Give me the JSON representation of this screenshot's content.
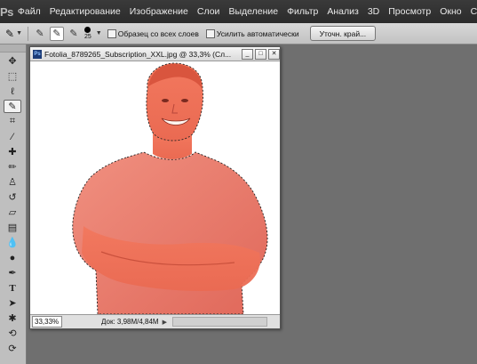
{
  "app": {
    "logo": "Ps"
  },
  "menu": [
    "Файл",
    "Редактирование",
    "Изображение",
    "Слои",
    "Выделение",
    "Фильтр",
    "Анализ",
    "3D",
    "Просмотр",
    "Окно",
    "Справка"
  ],
  "options": {
    "brush_size": "25",
    "sample_all_layers_label": "Образец со всех слоев",
    "auto_enhance_label": "Усилить автоматически",
    "refine_edge_label": "Уточн. край..."
  },
  "toolbox": {
    "tools": [
      "move-icon",
      "marquee-icon",
      "lasso-icon",
      "quick-selection-icon",
      "crop-icon",
      "eyedropper-icon",
      "healing-brush-icon",
      "brush-icon",
      "clone-stamp-icon",
      "history-brush-icon",
      "eraser-icon",
      "gradient-icon",
      "blur-icon",
      "dodge-icon",
      "pen-icon",
      "type-icon",
      "path-selection-icon",
      "shape-icon",
      "3d-rotate-icon",
      "3d-orbit-icon"
    ]
  },
  "document": {
    "title": "Fotolia_8789265_Subscription_XXL.jpg @ 33,3% (Сл...",
    "zoom": "33,33%",
    "doc_size": "Док: 3,98M/4,84M"
  },
  "colors": {
    "menubar": "#2e2e2e",
    "workspace": "#6f6f6f",
    "quick_mask": "#f0705a"
  }
}
